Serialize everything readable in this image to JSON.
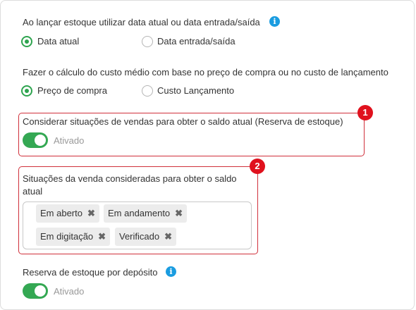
{
  "settings": {
    "stock_date": {
      "label": "Ao lançar estoque utilizar data atual ou data entrada/saída",
      "options": [
        "Data atual",
        "Data entrada/saída"
      ],
      "selected": "Data atual"
    },
    "avg_cost": {
      "label": "Fazer o cálculo do custo médio com base no preço de compra ou no custo de lançamento",
      "options": [
        "Preço de compra",
        "Custo Lançamento"
      ],
      "selected": "Preço de compra"
    },
    "reserve_sales": {
      "label": "Considerar situações de vendas para obter o saldo atual (Reserva de estoque)",
      "toggle_text": "Ativado",
      "badge": "1"
    },
    "sale_statuses": {
      "label_line1": "Situações da venda consideradas para obter o saldo",
      "label_line2": "atual",
      "badge": "2",
      "tags": [
        "Em aberto",
        "Em andamento",
        "Em digitação",
        "Verificado"
      ]
    },
    "reserve_by_warehouse": {
      "label": "Reserva de estoque por depósito",
      "toggle_text": "Ativado"
    }
  },
  "icons": {
    "info": "info-icon",
    "remove": "close-icon"
  },
  "colors": {
    "accent_green": "#2ea44f",
    "info_blue": "#1a9ce0",
    "highlight_red": "#d0303b"
  }
}
